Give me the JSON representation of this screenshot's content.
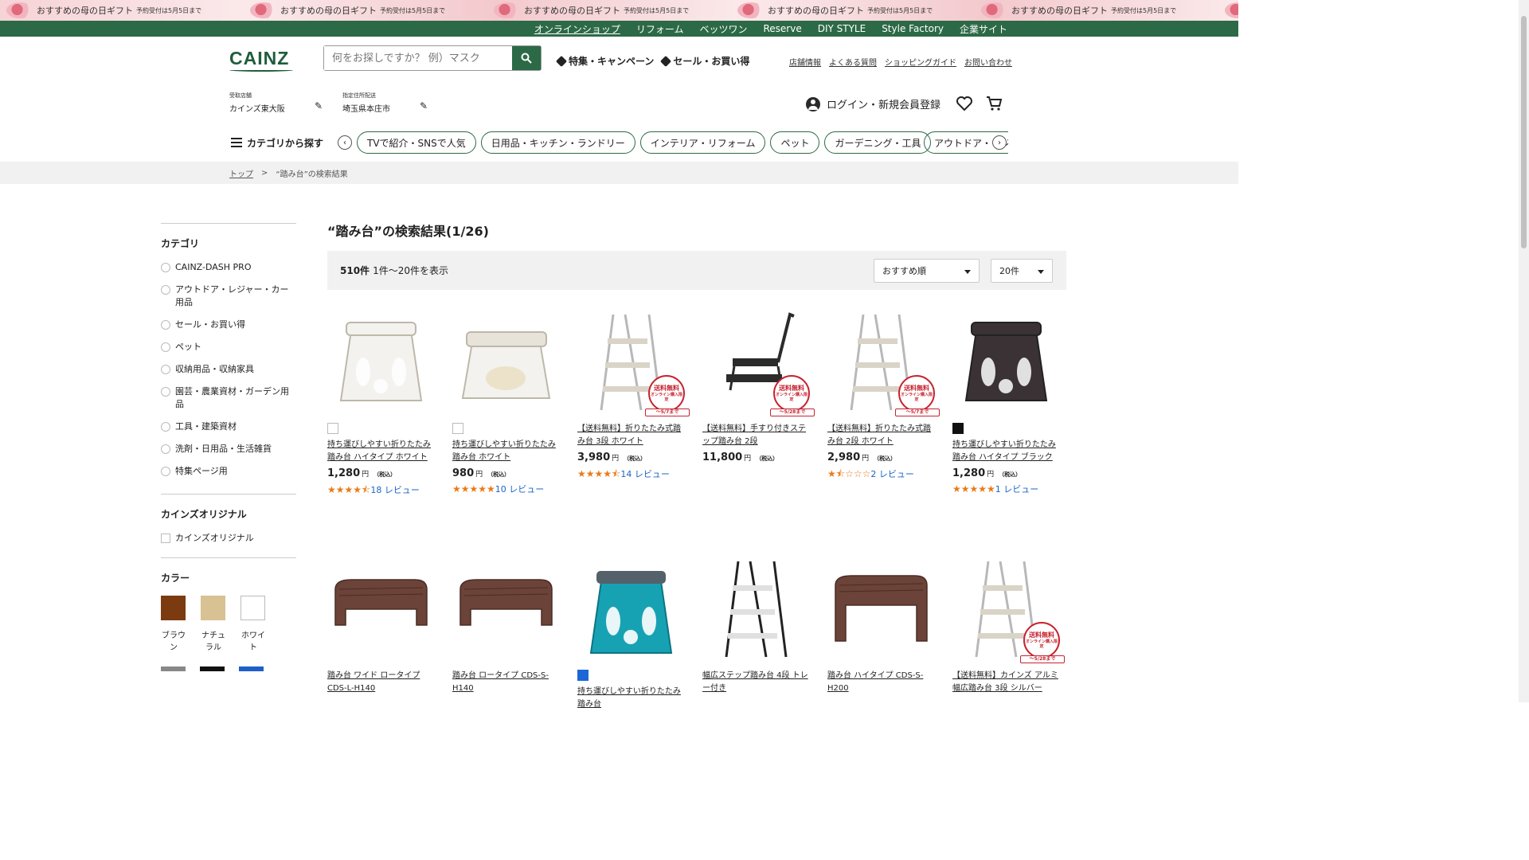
{
  "promo": {
    "text": "おすすめの母の日ギフト",
    "note": "予約受付は5月5日まで",
    "mark": "Happy Mother's Day"
  },
  "topnav": [
    "オンラインショップ",
    "リフォーム",
    "ベッツワン",
    "Reserve",
    "DIY STYLE",
    "Style Factory",
    "企業サイト"
  ],
  "header": {
    "logo": "CAINZ",
    "search_placeholder": "何をお探しですか？ 例）マスク",
    "links": [
      "特集・キャンペーン",
      "セール・お買い得"
    ],
    "util_links": [
      "店舗情報",
      "よくある質問",
      "ショッピングガイド",
      "お問い合わせ"
    ],
    "store_label": "受取店舗",
    "store_value": "カインズ東大阪",
    "delivery_label": "指定住所配送",
    "delivery_value": "埼玉県本庄市",
    "account": "ログイン・新規会員登録"
  },
  "catbar": {
    "menu": "カテゴリから探す",
    "chips": [
      "TVで紹介・SNSで人気",
      "日用品・キッチン・ランドリー",
      "インテリア・リフォーム",
      "ペット",
      "ガーデニング・工具",
      "アウトドア・レジャー"
    ]
  },
  "breadcrumb": {
    "top": "トップ",
    "sep": ">",
    "current": "“踏み台”の検索結果"
  },
  "sidebar": {
    "category_title": "カテゴリ",
    "categories": [
      "CAINZ-DASH PRO",
      "アウトドア・レジャー・カー用品",
      "セール・お買い得",
      "ペット",
      "収納用品・収納家具",
      "園芸・農業資材・ガーデン用品",
      "工具・建築資材",
      "洗剤・日用品・生活雑貨",
      "特集ページ用"
    ],
    "original_title": "カインズオリジナル",
    "original_option": "カインズオリジナル",
    "color_title": "カラー",
    "colors": [
      {
        "name": "ブラウン",
        "hex": "#7b3a10"
      },
      {
        "name": "ナチュラル",
        "hex": "#d8c193"
      },
      {
        "name": "ホワイト",
        "hex": "#ffffff"
      }
    ],
    "colors_row2": [
      "#888888",
      "#111111",
      "#1f5fc8"
    ]
  },
  "results": {
    "title": "“踏み台”の検索結果(1/26)",
    "count": "510件",
    "range": "1件〜20件を表示",
    "sort": "おすすめ順",
    "per_page": "20件"
  },
  "products": [
    {
      "name": "持ち運びしやすい折りたたみ踏み台 ハイタイプ ホワイト",
      "price": "1,280",
      "stars": "★★★★⯪",
      "reviews": "18 レビュー",
      "color": "#ffffff",
      "img": "stool-white-high"
    },
    {
      "name": "持ち運びしやすい折りたたみ踏み台 ホワイト",
      "price": "980",
      "stars": "★★★★★",
      "reviews": "10 レビュー",
      "color": "#ffffff",
      "img": "stool-white"
    },
    {
      "name": "【送料無料】折りたたみ式踏み台 3段 ホワイト",
      "price": "3,980",
      "stars": "★★★★⯪",
      "reviews": "14 レビュー",
      "color": "",
      "img": "ladder-3",
      "badge": "～5/7まで"
    },
    {
      "name": "【送料無料】手すり付きステップ踏み台 2段",
      "price": "11,800",
      "stars": "",
      "reviews": "",
      "color": "",
      "img": "step-handrail",
      "badge": "～5/28まで"
    },
    {
      "name": "【送料無料】折りたたみ式踏み台 2段 ホワイト",
      "price": "2,980",
      "stars": "★⯪☆☆☆",
      "reviews": "2 レビュー",
      "color": "",
      "img": "ladder-2",
      "badge": "～5/7まで"
    },
    {
      "name": "持ち運びしやすい折りたたみ踏み台 ハイタイプ ブラック",
      "price": "1,280",
      "stars": "★★★★★",
      "reviews": "1 レビュー",
      "color": "#111111",
      "img": "stool-black"
    },
    {
      "name": "踏み台 ワイド ロータイプ CDS-L-H140",
      "img": "bench-wide"
    },
    {
      "name": "踏み台 ロータイプ CDS-S-H140",
      "img": "bench-low"
    },
    {
      "name": "持ち運びしやすい折りたたみ踏み台",
      "img": "stool-teal",
      "color": "#1c66d6"
    },
    {
      "name": "幅広ステップ踏み台 4段 トレー付き",
      "img": "ladder-black"
    },
    {
      "name": "踏み台 ハイタイプ CDS-S-H200",
      "img": "bench-high"
    },
    {
      "name": "【送料無料】カインズ アルミ幅広踏み台 3段 シルバー",
      "img": "ladder-alu",
      "badge": "～5/28まで"
    }
  ],
  "badge_text": {
    "main": "送料無料",
    "sub": "オンライン購入限定"
  },
  "price_unit": "円",
  "tax_label": "（税込）"
}
